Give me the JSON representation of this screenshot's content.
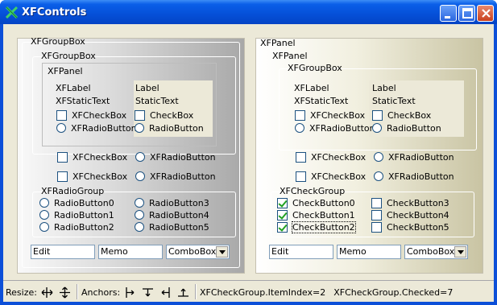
{
  "window": {
    "title": "XFControls",
    "icon": "x-app-icon",
    "buttons": [
      "minimize-icon",
      "maximize-icon",
      "close-icon"
    ]
  },
  "left": {
    "groupbox_outer_title": "XFGroupBox",
    "groupbox_inner_title": "XFGroupBox",
    "panel_title": "XFPanel",
    "label_caption": "XFLabel",
    "label_value": "Label",
    "statictext_caption": "XFStaticText",
    "statictext_value": "StaticText",
    "checkbox_a": "XFCheckBox",
    "checkbox_b": "CheckBox",
    "radio_a": "XFRadioButton",
    "radio_b": "RadioButton",
    "row1_check": "XFCheckBox",
    "row1_radio": "XFRadioButton",
    "row2_check": "XFCheckBox",
    "row2_radio": "XFRadioButton",
    "radiogroup_title": "XFRadioGroup",
    "radiogroup_items": [
      "RadioButton0",
      "RadioButton1",
      "RadioButton2",
      "RadioButton3",
      "RadioButton4",
      "RadioButton5"
    ],
    "edit_value": "Edit",
    "memo_value": "Memo",
    "combo_value": "ComboBox"
  },
  "right": {
    "panel_outer_title": "XFPanel",
    "panel_inner_title": "XFPanel",
    "groupbox_title": "XFGroupBox",
    "label_caption": "XFLabel",
    "label_value": "Label",
    "statictext_caption": "XFStaticText",
    "statictext_value": "StaticText",
    "checkbox_a": "XFCheckBox",
    "checkbox_b": "CheckBox",
    "radio_a": "XFRadioButton",
    "radio_b": "RadioButton",
    "row1_check": "XFCheckBox",
    "row1_radio": "XFRadioButton",
    "row2_check": "XFCheckBox",
    "row2_radio": "XFRadioButton",
    "checkgroup_title": "XFCheckGroup",
    "checkgroup_items": [
      "CheckButton0",
      "CheckButton1",
      "CheckButton2",
      "CheckButton3",
      "CheckButton4",
      "CheckButton5"
    ],
    "checkgroup_checked": [
      true,
      true,
      true,
      false,
      false,
      false
    ],
    "edit_value": "Edit",
    "memo_value": "Memo",
    "combo_value": "ComboBox"
  },
  "status": {
    "resize_label": "Resize:",
    "anchors_label": "Anchors:",
    "item_index_text": "XFCheckGroup.ItemIndex=2",
    "checked_text": "XFCheckGroup.Checked=7",
    "resize_icons": [
      "resize-horizontal-icon",
      "resize-vertical-icon"
    ],
    "anchor_icons": [
      "anchor-left-icon",
      "anchor-top-icon",
      "anchor-right-icon",
      "anchor-bottom-icon"
    ]
  }
}
